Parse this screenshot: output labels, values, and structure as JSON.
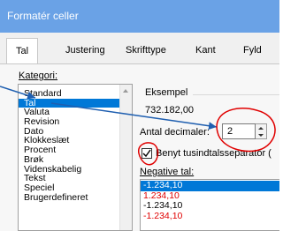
{
  "window": {
    "title": "Formatér celler"
  },
  "tabs": [
    {
      "label": "Tal",
      "active": true
    },
    {
      "label": "Justering"
    },
    {
      "label": "Skrifttype"
    },
    {
      "label": "Kant"
    },
    {
      "label": "Fyld"
    }
  ],
  "category": {
    "label": "Kategori:",
    "items": [
      "Standard",
      "Tal",
      "Valuta",
      "Revision",
      "Dato",
      "Klokkeslæt",
      "Procent",
      "Brøk",
      "Videnskabelig",
      "Tekst",
      "Speciel",
      "Brugerdefineret"
    ],
    "selected_index": 1
  },
  "sample": {
    "label": "Eksempel",
    "value": "732.182,00"
  },
  "decimals": {
    "label": "Antal decimaler:",
    "value": "2"
  },
  "thousands": {
    "label": "Benyt tusindtalsseparator (",
    "checked": true
  },
  "negative": {
    "label": "Negative tal:",
    "items": [
      {
        "text": "-1.234,10",
        "color": "#ffffff",
        "selected": true
      },
      {
        "text": "1.234,10",
        "color": "#e00000"
      },
      {
        "text": "-1.234,10",
        "color": "#000000"
      },
      {
        "text": "-1.234,10",
        "color": "#e00000"
      }
    ]
  },
  "colors": {
    "title_bar": "#6aa2e6",
    "selection": "#0078d7",
    "annotation": "#e00000",
    "arrow": "#1f5fb0"
  }
}
